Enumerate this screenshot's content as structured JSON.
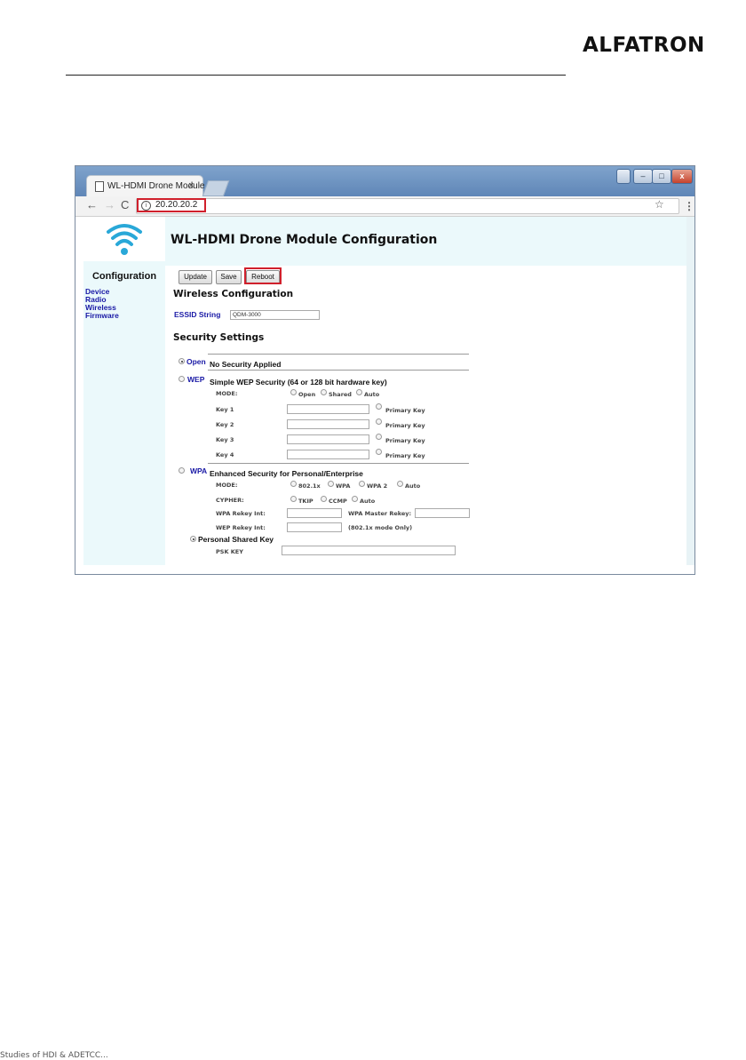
{
  "brand": {
    "logo_text": "ALFATRON"
  },
  "footer": {
    "text": "Studies of HDI & ADETCC..."
  },
  "browser": {
    "tab_title": "WL-HDMI Drone Module",
    "tab_close": "×",
    "url": "20.20.20.2",
    "nav": {
      "back": "←",
      "forward": "→",
      "reload": "C"
    },
    "star": "☆",
    "menu": "⋮",
    "window_controls": {
      "person": "👤",
      "minimize": "–",
      "maximize": "□",
      "close": "x"
    }
  },
  "page": {
    "title": "WL-HDMI Drone Module Configuration",
    "sidebar": {
      "heading": "Configuration",
      "links": [
        "Device",
        "Radio",
        "Wireless",
        "Firmware"
      ]
    },
    "buttons": {
      "update": "Update",
      "save": "Save",
      "reboot": "Reboot"
    },
    "wireless": {
      "heading": "Wireless Configuration",
      "essid_label": "ESSID String",
      "essid_value": "QDM-3000"
    },
    "security": {
      "heading": "Security Settings",
      "open": {
        "label": "Open",
        "desc": "No Security Applied",
        "selected": true
      },
      "wep": {
        "label": "WEP",
        "desc": "Simple WEP Security (64 or 128 bit hardware key)",
        "mode_label": "MODE:",
        "modes": [
          "Open",
          "Shared",
          "Auto"
        ],
        "keys": [
          "Key 1",
          "Key 2",
          "Key 3",
          "Key 4"
        ],
        "primary_label": "Primary Key"
      },
      "wpa": {
        "label": "WPA",
        "desc": "Enhanced Security for Personal/Enterprise",
        "mode_label": "MODE:",
        "modes": [
          "802.1x",
          "WPA",
          "WPA 2",
          "Auto"
        ],
        "cypher_label": "CYPHER:",
        "cyphers": [
          "TKIP",
          "CCMP",
          "Auto"
        ],
        "rekey_label": "WPA Rekey Int:",
        "master_rekey_label": "WPA Master Rekey:",
        "wep_rekey_label": "WEP Rekey Int:",
        "wep_rekey_note": "(802.1x mode Only)",
        "psk_option": "Personal Shared Key",
        "psk_label": "PSK KEY"
      }
    }
  },
  "colors": {
    "highlight": "#d0202c",
    "link": "#1a1aa6",
    "panel": "#ebf9fb",
    "titlebar": "#6f95c3"
  }
}
